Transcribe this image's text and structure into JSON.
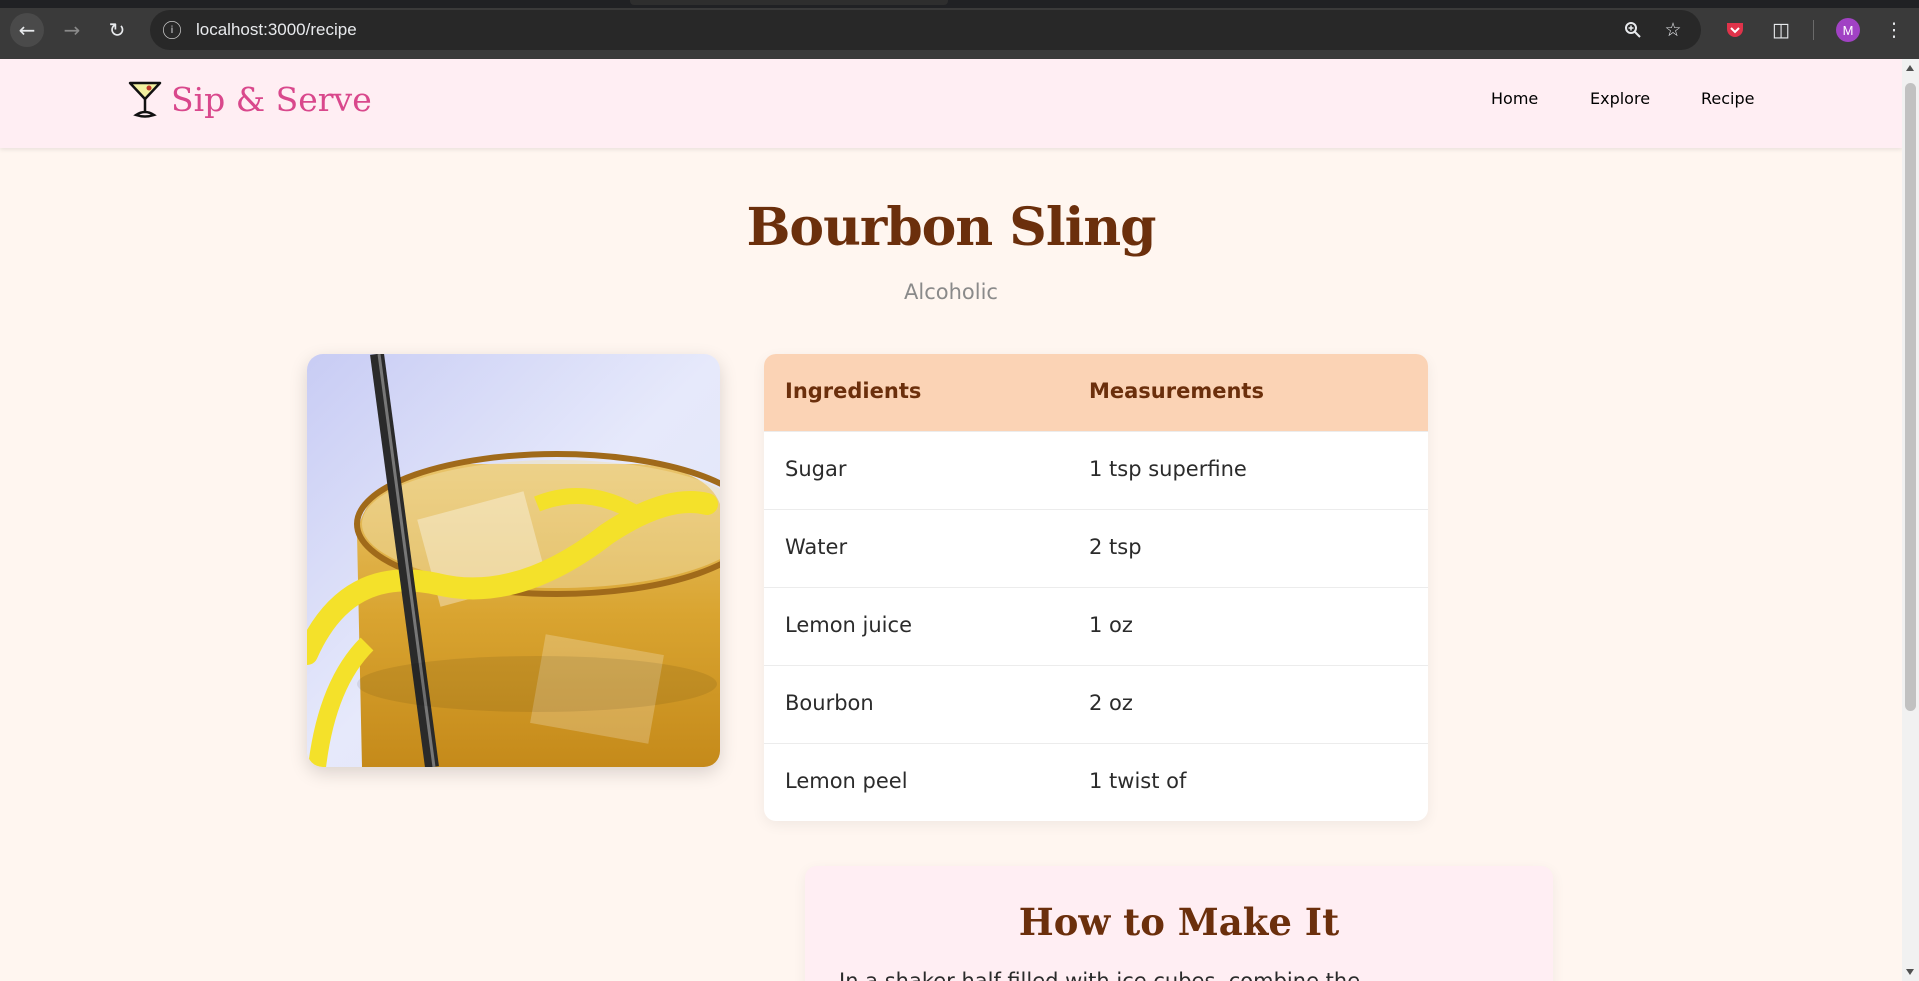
{
  "browser": {
    "url": "localhost:3000/recipe",
    "avatar_letter": "M",
    "avatar_color": "#a142c4"
  },
  "header": {
    "brand": "Sip & Serve",
    "nav": [
      {
        "label": "Home"
      },
      {
        "label": "Explore"
      },
      {
        "label": "Recipe"
      }
    ],
    "accent_color": "#d9488c"
  },
  "recipe": {
    "title": "Bourbon Sling",
    "category": "Alcoholic",
    "table": {
      "headers": [
        "Ingredients",
        "Measurements"
      ],
      "rows": [
        [
          "Sugar",
          "1 tsp superfine"
        ],
        [
          "Water",
          "2 tsp"
        ],
        [
          "Lemon juice",
          "1 oz"
        ],
        [
          "Bourbon",
          "2 oz"
        ],
        [
          "Lemon peel",
          "1 twist of"
        ]
      ]
    },
    "howto": {
      "title": "How to Make It",
      "text": "In a shaker half-filled with ice cubes, combine the"
    }
  },
  "colors": {
    "title": "#6b2f0c",
    "table_header_bg": "#fbd3b5",
    "page_bg": "#fff6f0"
  }
}
